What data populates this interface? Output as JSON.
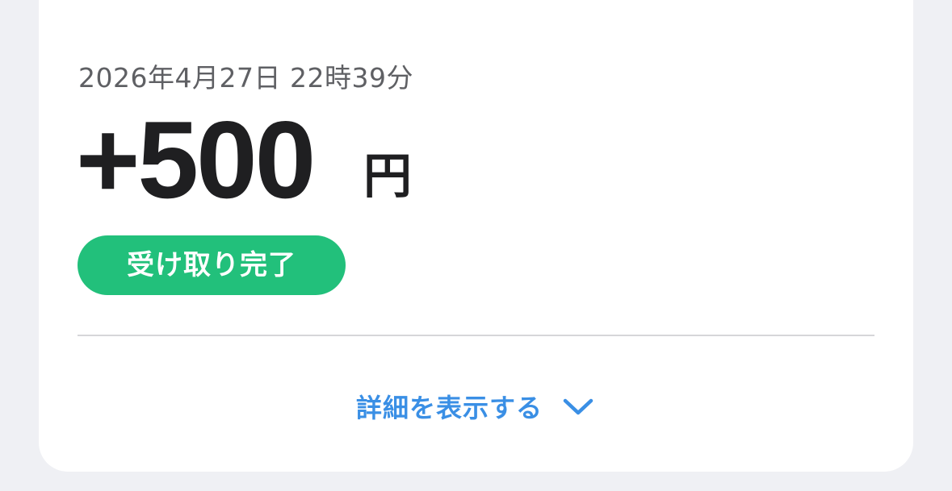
{
  "transaction": {
    "datetime": "2026年4月27日 22時39分",
    "amount": "+500",
    "currency": "円",
    "status": "受け取り完了"
  },
  "details": {
    "toggle_label": "詳細を表示する",
    "toggle_icon": "chevron-down-icon"
  },
  "colors": {
    "status_green": "#22c07b",
    "link_blue": "#3a8fe5",
    "background": "#eff0f4"
  }
}
